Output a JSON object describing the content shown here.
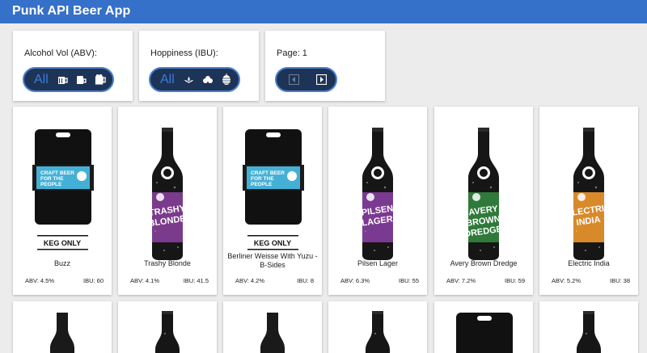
{
  "app": {
    "title": "Punk API Beer App"
  },
  "filters": {
    "abv": {
      "label": "Alcohol Vol (ABV):",
      "all_label": "All",
      "options": [
        "small-glass-icon",
        "mug-icon",
        "large-mug-icon"
      ]
    },
    "ibu": {
      "label": "Hoppiness (IBU):",
      "all_label": "All",
      "options": [
        "hop-leaf-small-icon",
        "hop-leaf-medium-icon",
        "hop-cone-icon"
      ]
    },
    "page": {
      "label": "Page: 1",
      "prev_icon": "prev-page-icon",
      "next_icon": "next-page-icon"
    }
  },
  "beers": [
    {
      "name": "Buzz",
      "abv": "ABV: 4.5%",
      "ibu": "IBU: 60",
      "image": "keg",
      "keg_label": "KEG ONLY",
      "sticker": "CRAFT BEER FOR THE PEOPLE"
    },
    {
      "name": "Trashy Blonde",
      "abv": "ABV: 4.1%",
      "ibu": "IBU: 41.5",
      "image": "bottle",
      "label_color": "#7a3b8c",
      "label_text": "TRASHY BLONDE"
    },
    {
      "name": "Berliner Weisse With Yuzu - B-Sides",
      "abv": "ABV: 4.2%",
      "ibu": "IBU: 8",
      "image": "keg",
      "keg_label": "KEG ONLY",
      "sticker": "CRAFT BEER FOR THE PEOPLE"
    },
    {
      "name": "Pilsen Lager",
      "abv": "ABV: 6.3%",
      "ibu": "IBU: 55",
      "image": "bottle",
      "label_color": "#7b3a91",
      "label_text": "PILSEN LAGER"
    },
    {
      "name": "Avery Brown Dredge",
      "abv": "ABV: 7.2%",
      "ibu": "IBU: 59",
      "image": "bottle",
      "label_color": "#2f7a3a",
      "label_text": "AVERY BROWN DREDGE"
    },
    {
      "name": "Electric India",
      "abv": "ABV: 5.2%",
      "ibu": "IBU: 38",
      "image": "bottle",
      "label_color": "#d88a2b",
      "label_text": "ELECTRIC INDIA"
    }
  ],
  "row2_images": [
    "bottle-silhouette",
    "bottle",
    "bottle-silhouette",
    "bottle",
    "keg",
    "bottle"
  ]
}
